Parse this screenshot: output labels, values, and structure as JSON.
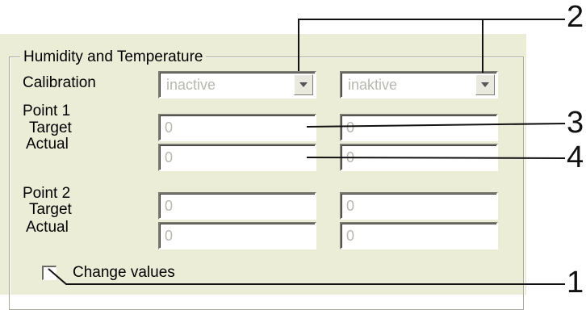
{
  "group": {
    "title": "Humidity and Temperature"
  },
  "calibration": {
    "label": "Calibration",
    "left_value": "inactive",
    "right_value": "inaktive"
  },
  "point1": {
    "label": "Point 1",
    "target_label": "Target",
    "actual_label": "Actual",
    "target_left": "0",
    "target_right": "0",
    "actual_left": "0",
    "actual_right": "0"
  },
  "point2": {
    "label": "Point 2",
    "target_label": "Target",
    "actual_label": "Actual",
    "target_left": "0",
    "target_right": "0",
    "actual_left": "0",
    "actual_right": "0"
  },
  "change_values": {
    "label": "Change values",
    "checked": false
  },
  "callouts": [
    "2",
    "3",
    "4",
    "1"
  ],
  "icons": {
    "dropdown": "chevron-down-icon"
  }
}
